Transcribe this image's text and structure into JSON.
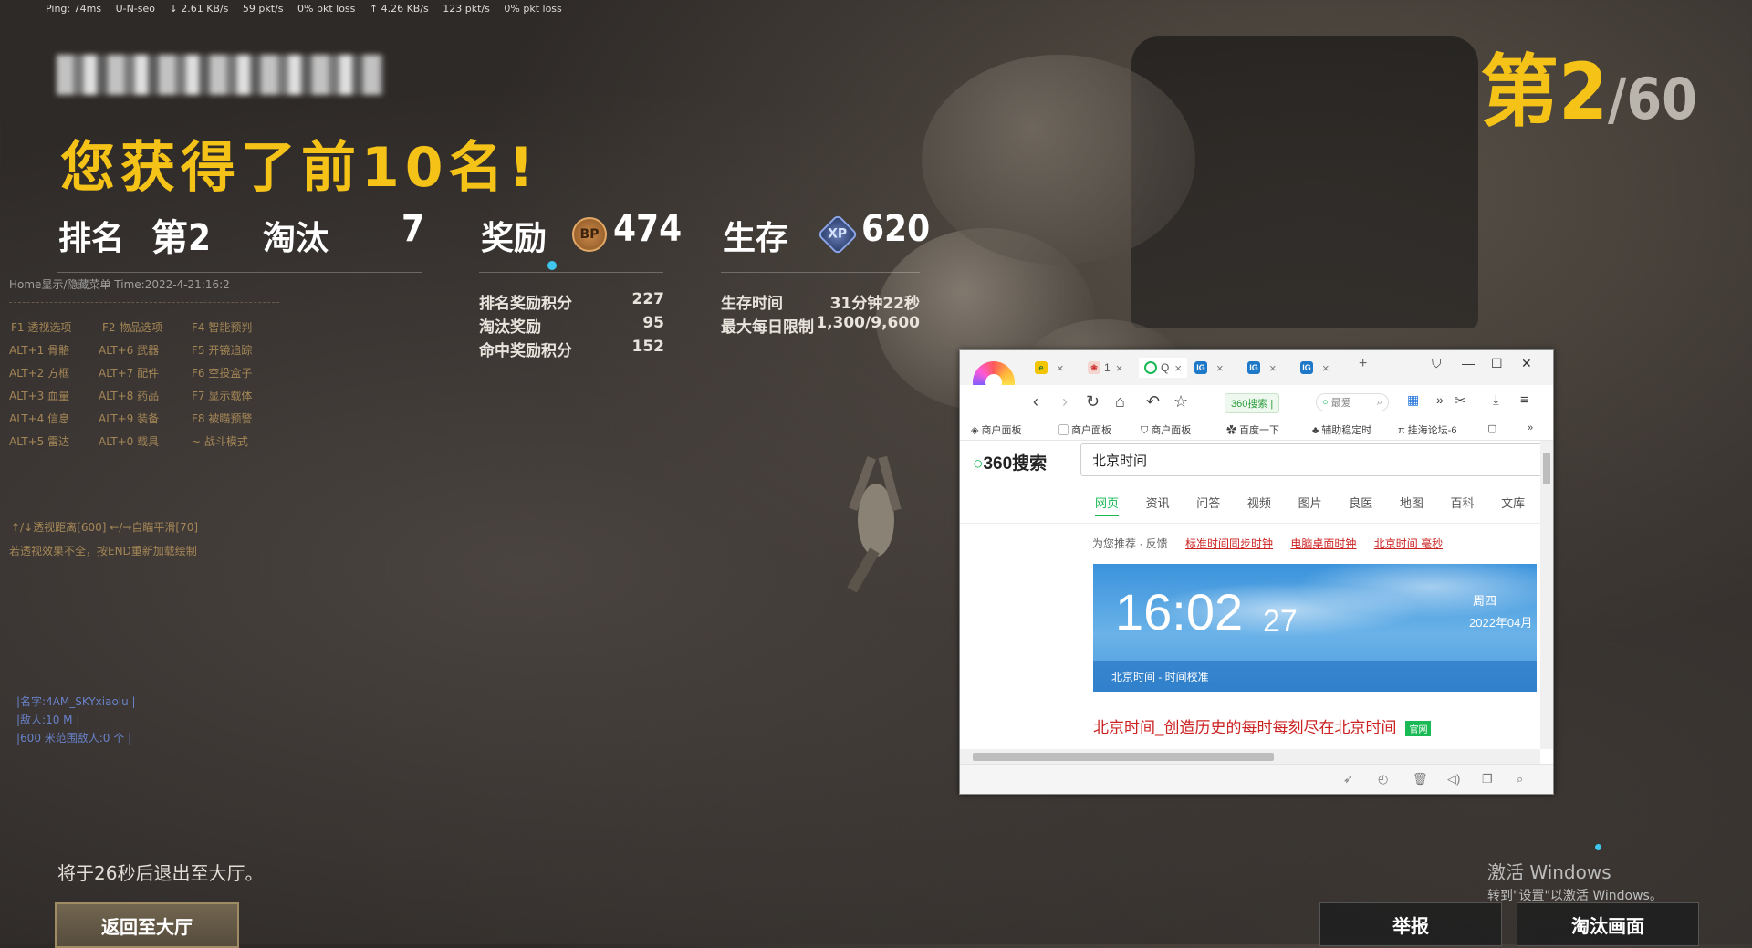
{
  "netstats": [
    "Ping: 74ms",
    "U-N-seo",
    "↓ 2.61 KB/s",
    "59 pkt/s",
    "0% pkt loss",
    "↑ 4.26 KB/s",
    "123 pkt/s",
    "0% pkt loss"
  ],
  "rank_top": {
    "current": "第2",
    "total": "/60"
  },
  "headline": "您获得了前10名!",
  "stats": {
    "rank_label": "排名",
    "rank_value": "第2",
    "kill_label": "淘汰",
    "kill_value": "7",
    "reward_label": "奖励",
    "bp_badge": "BP",
    "bp_value": "474",
    "survive_label": "生存",
    "xp_badge": "XP",
    "xp_value": "620"
  },
  "reward_details": [
    {
      "label": "排名奖励积分",
      "value": "227"
    },
    {
      "label": "淘汰奖励",
      "value": "95"
    },
    {
      "label": "命中奖励积分",
      "value": "152"
    }
  ],
  "survive_details": [
    {
      "label": "生存时间",
      "value": "31分钟22秒"
    },
    {
      "label": "最大每日限制",
      "value": "1,300/9,600"
    }
  ],
  "overlay_menu": {
    "header": "Home显示/隐藏菜单   Time:2022-4-21:16:2",
    "col1": [
      "F1 透视选项",
      "ALT+1 骨骼",
      "ALT+2 方框",
      "ALT+3 血量",
      "ALT+4 信息",
      "ALT+5 雷达"
    ],
    "col2": [
      "F2 物品选项",
      "ALT+6 武器",
      "ALT+7 配件",
      "ALT+8 药品",
      "ALT+9 装备",
      "ALT+0 载具"
    ],
    "col3": [
      "F4 智能预判",
      "F5 开镜追踪",
      "F6 空投盒子",
      "F7 显示载体",
      "F8 被瞄预警",
      "~ 战斗模式"
    ],
    "dist": "↑/↓透视距离[600] ←/→自瞄平滑[70]",
    "note": "若透视效果不全，按END重新加载绘制",
    "info": [
      "|名字:4AM_SKYxiaolu |",
      "|敌人:10 M |",
      "|600 米范围敌人:0 个 |"
    ]
  },
  "exit_message": "将于26秒后退出至大厅。",
  "buttons": {
    "lobby": "返回至大厅",
    "report": "举报",
    "elim": "淘汰画面"
  },
  "windows_activation": {
    "title": "激活 Windows",
    "sub": "转到\"设置\"以激活 Windows。"
  },
  "browser": {
    "tabs": [
      {
        "label": "1"
      },
      {
        "label": "Q"
      }
    ],
    "url_chip": "360搜索 |",
    "search_pill": "最爱",
    "bookmarks": [
      "商户面板",
      "商户面板",
      "商户面板",
      "百度一下",
      "辅助稳定时",
      "挂海论坛-6"
    ],
    "logo_text": "360搜索",
    "query": "北京时间",
    "search_tabs": [
      "网页",
      "资讯",
      "问答",
      "视频",
      "图片",
      "良医",
      "地图",
      "百科",
      "文库"
    ],
    "recommend_label": "为您推荐 · 反馈",
    "recommend_links": [
      "标准时间同步时钟",
      "电脑桌面时钟",
      "北京时间 毫秒"
    ],
    "clock_time": "16:02",
    "clock_sec": "27",
    "clock_weekday": "周四",
    "clock_date": "2022年04月",
    "clock_bottom": "北京时间 - 时间校准",
    "result_title": "北京时间_创造历史的每时每刻尽在北京时间",
    "result_tag": "官网"
  }
}
